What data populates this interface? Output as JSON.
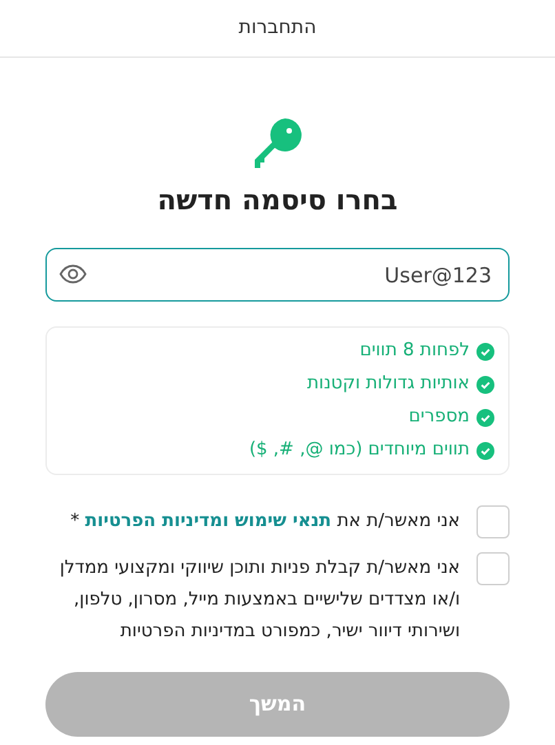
{
  "header": {
    "title": "התחברות"
  },
  "heading": "בחרו סיסמה חדשה",
  "password_field": {
    "value": "User@123",
    "focused": true
  },
  "requirements": [
    {
      "label": "לפחות 8 תווים",
      "met": true
    },
    {
      "label": "אותיות גדולות וקטנות",
      "met": true
    },
    {
      "label": "מספרים",
      "met": true
    },
    {
      "label": "תווים מיוחדים (כמו @, #, $)",
      "met": true
    }
  ],
  "consents": [
    {
      "prefix": "אני מאשר/ת את",
      "link": "תנאי שימוש ומדיניות הפרטיות",
      "suffix": "*",
      "checked": false
    },
    {
      "prefix": "אני מאשר/ת קבלת פניות ותוכן שיווקי ומקצועי ממדלן ו/או מצדדים שלישיים באמצעות מייל, מסרון, טלפון, ושירותי דיוור ישיר, כמפורט במדיניות הפרטיות",
      "checked": false
    }
  ],
  "continue_button": {
    "label": "המשך",
    "disabled": true
  }
}
